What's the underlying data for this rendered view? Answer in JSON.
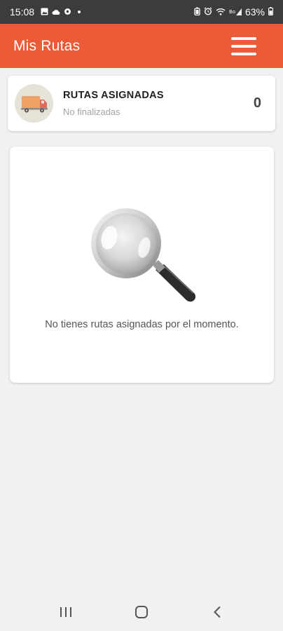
{
  "status_bar": {
    "time": "15:08",
    "battery": "63%",
    "icons": [
      "image-icon",
      "cloud-icon",
      "settings-icon",
      "dot-icon",
      "battery-saver-icon",
      "alarm-icon",
      "wifi-icon",
      "signal-icon",
      "battery-icon"
    ]
  },
  "app_bar": {
    "title": "Mis Rutas",
    "menu_icon": "hamburger-menu-icon"
  },
  "summary": {
    "title": "RUTAS ASIGNADAS",
    "subtitle": "No finalizadas",
    "count": "0",
    "icon": "truck-icon"
  },
  "empty_state": {
    "icon": "magnifying-glass-icon",
    "message": "No tienes rutas asignadas por el momento."
  },
  "nav_bar": {
    "buttons": [
      "recent-apps-icon",
      "home-icon",
      "back-icon"
    ]
  },
  "colors": {
    "accent": "#ec5a37",
    "background": "#f1f1f1",
    "card": "#ffffff"
  }
}
